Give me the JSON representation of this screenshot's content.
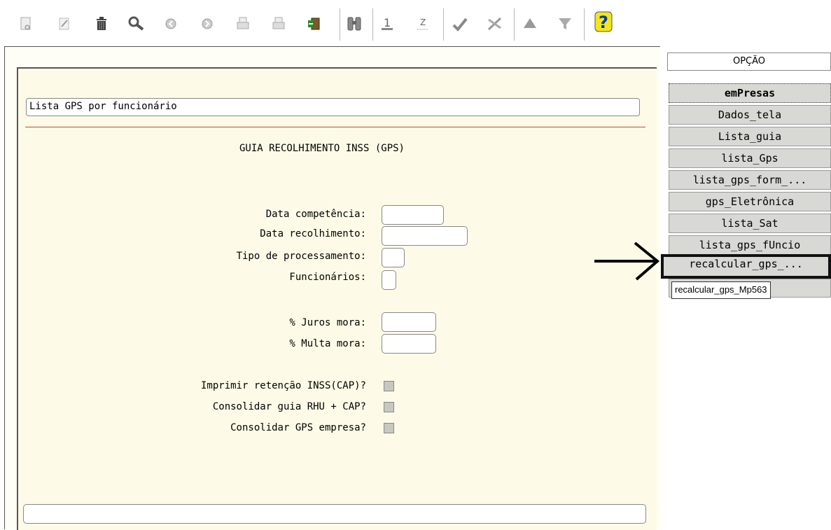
{
  "form": {
    "title": "Lista GPS por funcionário",
    "heading": "GUIA RECOLHIMENTO INSS (GPS)",
    "fields": {
      "data_competencia": "Data competência:",
      "data_recolhimento": "Data recolhimento:",
      "tipo_processamento": "Tipo de processamento:",
      "funcionarios": "Funcionários:",
      "juros_mora": "% Juros mora:",
      "multa_mora": "% Multa mora:"
    },
    "checks": {
      "imprimir_retencao": "Imprimir retenção INSS(CAP)?",
      "consolidar_rhu_cap": "Consolidar guia RHU + CAP?",
      "consolidar_gps": "Consolidar GPS empresa?"
    }
  },
  "sidebar": {
    "header": "OPÇÃO",
    "items": [
      "emPresas",
      "Dados_tela",
      "Lista_guia",
      "lista_Gps",
      "lista_gps_form_...",
      "gps_Eletrônica",
      "lista_Sat",
      "lista_gps_fUncio",
      "recalcular_gps_..."
    ],
    "tooltip": "recalcular_gps_Mp563"
  },
  "toolbar_icons": [
    "new-doc-icon",
    "edit-icon",
    "trash-icon",
    "search-icon",
    "previous-icon",
    "next-icon",
    "print-icon",
    "print-preview-icon",
    "exit-door-icon",
    "binoculars-icon",
    "sort-asc-icon",
    "sort-desc-icon",
    "check-icon",
    "tools-icon",
    "up-icon",
    "filter-icon",
    "help-icon"
  ]
}
